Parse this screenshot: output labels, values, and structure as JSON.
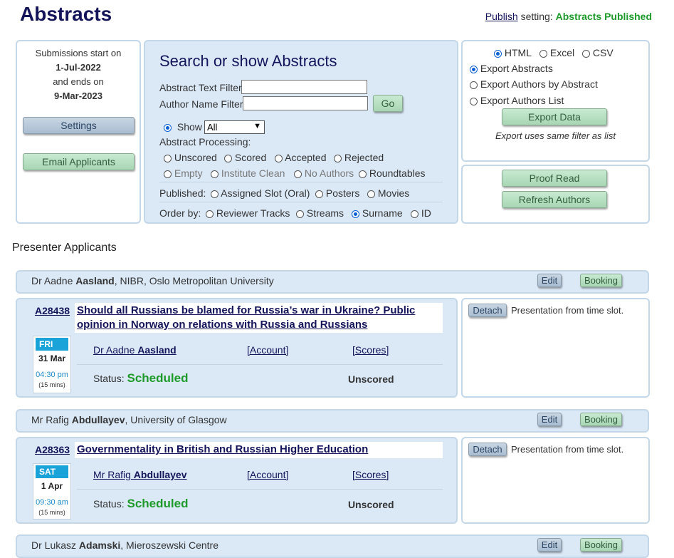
{
  "page": {
    "title": "Abstracts",
    "publish_link": "Publish",
    "publish_label": "setting:",
    "publish_status": "Abstracts Published"
  },
  "submissions": {
    "start_label": "Submissions start on",
    "start_date": "1-Jul-2022",
    "end_label": "and ends on",
    "end_date": "9-Mar-2023",
    "settings_button": "Settings",
    "email_button": "Email Applicants"
  },
  "search": {
    "heading": "Search or show Abstracts",
    "text_filter_label": "Abstract Text Filter:",
    "text_filter_value": "",
    "author_filter_label": "Author Name Filter:",
    "author_filter_value": "",
    "go_button": "Go",
    "show_label": "Show",
    "show_value": "All",
    "processing_label": "Abstract Processing:",
    "processing_options": [
      "Unscored",
      "Scored",
      "Accepted",
      "Rejected"
    ],
    "processing_options_2": [
      "Empty",
      "Institute Clean",
      "No Authors",
      "Roundtables"
    ],
    "published_label": "Published:",
    "published_options": [
      "Assigned Slot (Oral)",
      "Posters",
      "Movies"
    ],
    "order_label": "Order by:",
    "order_options": [
      "Reviewer Tracks",
      "Streams",
      "Surname",
      "ID"
    ],
    "order_selected": "Surname"
  },
  "export": {
    "formats": [
      "HTML",
      "Excel",
      "CSV"
    ],
    "format_selected": "HTML",
    "types": [
      "Export Abstracts",
      "Export Authors by Abstract",
      "Export Authors List"
    ],
    "type_selected": "Export Abstracts",
    "export_button": "Export Data",
    "note": "Export uses same filter as list"
  },
  "tools": {
    "proof_read_button": "Proof Read",
    "refresh_authors_button": "Refresh Authors"
  },
  "section_title": "Presenter Applicants",
  "applicants": [
    {
      "name_prefix": "Dr Aadne",
      "surname": "Aasland",
      "affiliation": ", NIBR, Oslo Metropolitan University",
      "edit_button": "Edit",
      "booking_button": "Booking",
      "abstract_id": "A28438",
      "abstract_title_line1": "Should all Russians be blamed for Russia’s war in Ukraine? Public",
      "abstract_title_line2": "opinion in Norway on relations with Russia and Russians",
      "day": "FRI",
      "date": "31 Mar",
      "time": "04:30 pm",
      "duration": "(15 mins)",
      "author_prefix": "Dr Aadne",
      "author_surname": "Aasland",
      "account_link": "[Account]",
      "scores_link": "[Scores]",
      "status_label": "Status:",
      "status": "Scheduled",
      "score_status": "Unscored",
      "detach_button": "Detach",
      "detach_text": "Presentation from time slot."
    },
    {
      "name_prefix": "Mr Rafig",
      "surname": "Abdullayev",
      "affiliation": ", University of Glasgow",
      "edit_button": "Edit",
      "booking_button": "Booking",
      "abstract_id": "A28363",
      "abstract_title_line1": "Governmentality in British and Russian Higher Education",
      "abstract_title_line2": "",
      "day": "SAT",
      "date": "1 Apr",
      "time": "09:30 am",
      "duration": "(15 mins)",
      "author_prefix": "Mr Rafig",
      "author_surname": "Abdullayev",
      "account_link": "[Account]",
      "scores_link": "[Scores]",
      "status_label": "Status:",
      "status": "Scheduled",
      "score_status": "Unscored",
      "detach_button": "Detach",
      "detach_text": "Presentation from time slot."
    },
    {
      "name_prefix": "Dr Lukasz",
      "surname": "Adamski",
      "affiliation": ", Mieroszewski Centre",
      "edit_button": "Edit",
      "booking_button": "Booking"
    }
  ],
  "colors": {
    "title": "#14145a",
    "published_green": "#1e9a2a",
    "panel_blue": "#dbe9f7",
    "panel_border": "#c4d7e8"
  }
}
